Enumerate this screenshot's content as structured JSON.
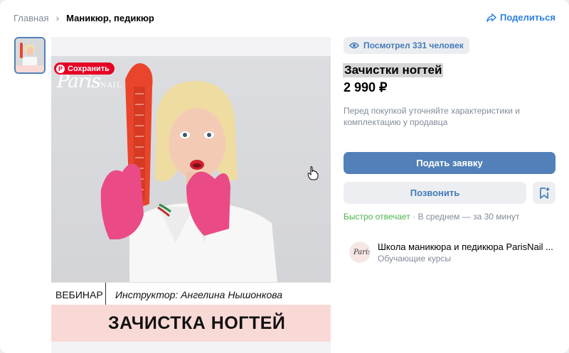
{
  "breadcrumb": {
    "home": "Главная",
    "current": "Маникюр, педикюр"
  },
  "share_label": "Поделиться",
  "image_overlay": {
    "save_label": "Сохранить",
    "logo_text": "Paris",
    "logo_suffix": "NAIL",
    "webinar": "ВЕБИНАР",
    "instructor": "Инструктор: Ангелина Нышонкова",
    "course_title": "ЗАЧИСТКА НОГТЕЙ"
  },
  "views_label": "Посмотрел 331 человек",
  "product": {
    "title": "Зачистки ногтей",
    "price": "2 990 ₽",
    "note": "Перед покупкой уточняйте характеристики и комплектацию у продавца"
  },
  "actions": {
    "apply": "Подать заявку",
    "call": "Позвонить"
  },
  "reply": {
    "fast": "Быстро отвечает",
    "average": " · В среднем — за 30 минут"
  },
  "shop": {
    "name": "Школа маникюра и педикюра ParisNail ...",
    "category": "Обучающие курсы"
  },
  "colors": {
    "accent": "#5181b8",
    "link": "#2d81e0",
    "success": "#4bb34b",
    "pin_red": "#e60023",
    "band": "#f9d9d6"
  }
}
